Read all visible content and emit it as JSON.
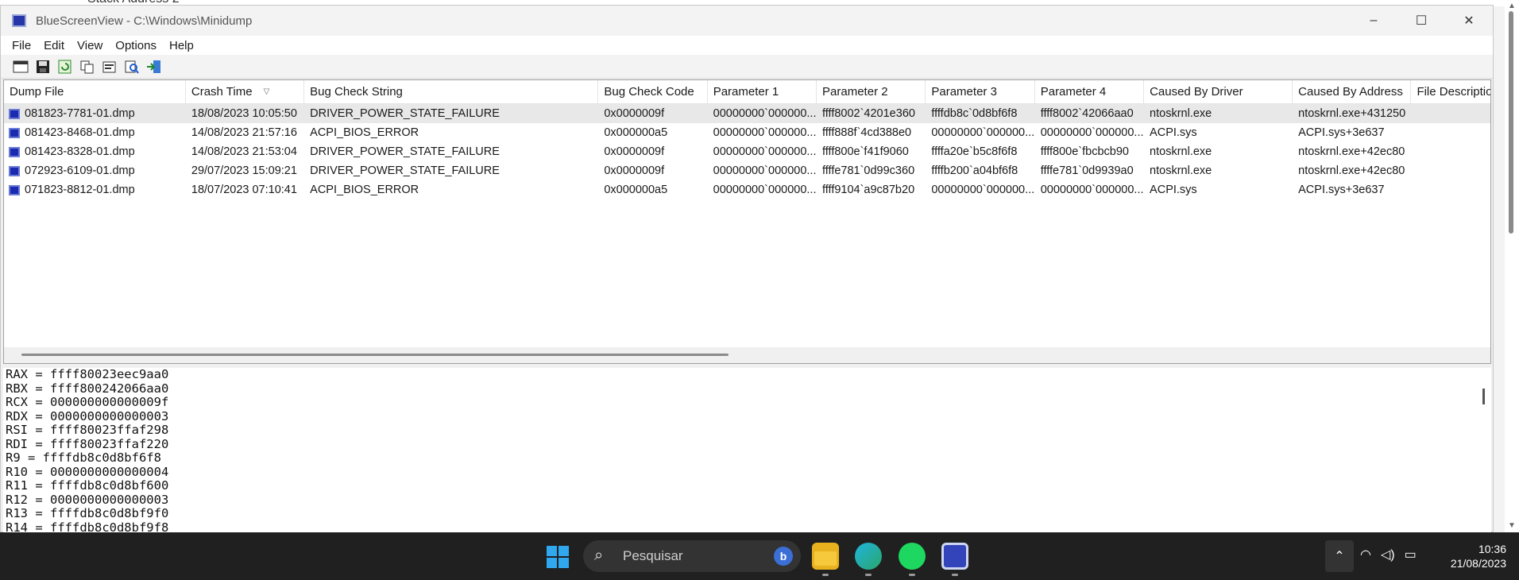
{
  "background_window": {
    "partial_text": "Stack Address 2"
  },
  "window": {
    "title": "BlueScreenView  -  C:\\Windows\\Minidump",
    "controls": [
      "–",
      "☐",
      "✕"
    ]
  },
  "menu": [
    "File",
    "Edit",
    "View",
    "Options",
    "Help"
  ],
  "toolbar_icons": [
    "html-report-icon",
    "save-icon",
    "refresh-icon",
    "copy-icon",
    "properties-icon",
    "find-icon",
    "exit-icon"
  ],
  "columns": [
    "Dump File",
    "Crash Time",
    "Bug Check String",
    "Bug Check Code",
    "Parameter 1",
    "Parameter 2",
    "Parameter 3",
    "Parameter 4",
    "Caused By Driver",
    "Caused By Address",
    "File Descriptio"
  ],
  "rows": [
    [
      "081823-7781-01.dmp",
      "18/08/2023 10:05:50",
      "DRIVER_POWER_STATE_FAILURE",
      "0x0000009f",
      "00000000`000000...",
      "ffff8002`4201e360",
      "ffffdb8c`0d8bf6f8",
      "ffff8002`42066aa0",
      "ntoskrnl.exe",
      "ntoskrnl.exe+431250",
      ""
    ],
    [
      "081423-8468-01.dmp",
      "14/08/2023 21:57:16",
      "ACPI_BIOS_ERROR",
      "0x000000a5",
      "00000000`000000...",
      "ffff888f`4cd388e0",
      "00000000`000000...",
      "00000000`000000...",
      "ACPI.sys",
      "ACPI.sys+3e637",
      ""
    ],
    [
      "081423-8328-01.dmp",
      "14/08/2023 21:53:04",
      "DRIVER_POWER_STATE_FAILURE",
      "0x0000009f",
      "00000000`000000...",
      "ffff800e`f41f9060",
      "ffffa20e`b5c8f6f8",
      "ffff800e`fbcbcb90",
      "ntoskrnl.exe",
      "ntoskrnl.exe+42ec80",
      ""
    ],
    [
      "072923-6109-01.dmp",
      "29/07/2023 15:09:21",
      "DRIVER_POWER_STATE_FAILURE",
      "0x0000009f",
      "00000000`000000...",
      "ffffe781`0d99c360",
      "ffffb200`a04bf6f8",
      "ffffe781`0d9939a0",
      "ntoskrnl.exe",
      "ntoskrnl.exe+42ec80",
      ""
    ],
    [
      "071823-8812-01.dmp",
      "18/07/2023 07:10:41",
      "ACPI_BIOS_ERROR",
      "0x000000a5",
      "00000000`000000...",
      "ffff9104`a9c87b20",
      "00000000`000000...",
      "00000000`000000...",
      "ACPI.sys",
      "ACPI.sys+3e637",
      ""
    ]
  ],
  "registers": [
    "RAX = ffff80023eec9aa0",
    "RBX = ffff800242066aa0",
    "RCX = 000000000000009f",
    "RDX = 0000000000000003",
    "RSI = ffff80023ffaf298",
    "RDI = ffff80023ffaf220",
    "R9 = ffffdb8c0d8bf6f8",
    "R10 = 0000000000000004",
    "R11 = ffffdb8c0d8bf600",
    "R12 = 0000000000000003",
    "R13 = ffffdb8c0d8bf9f0",
    "R14 = ffffdb8c0d8bf9f8"
  ],
  "taskbar": {
    "search_placeholder": "Pesquisar",
    "bing_label": "b",
    "apps": [
      "file-explorer-icon",
      "edge-icon",
      "spotify-icon",
      "bluescreenview-icon"
    ],
    "tray_chevron": "⌃",
    "clock_time": "10:36",
    "clock_date": "21/08/2023"
  },
  "colors": {
    "accent": "#1a2bb0",
    "taskbar": "#202020",
    "selected_row": "#e8e8e8"
  }
}
